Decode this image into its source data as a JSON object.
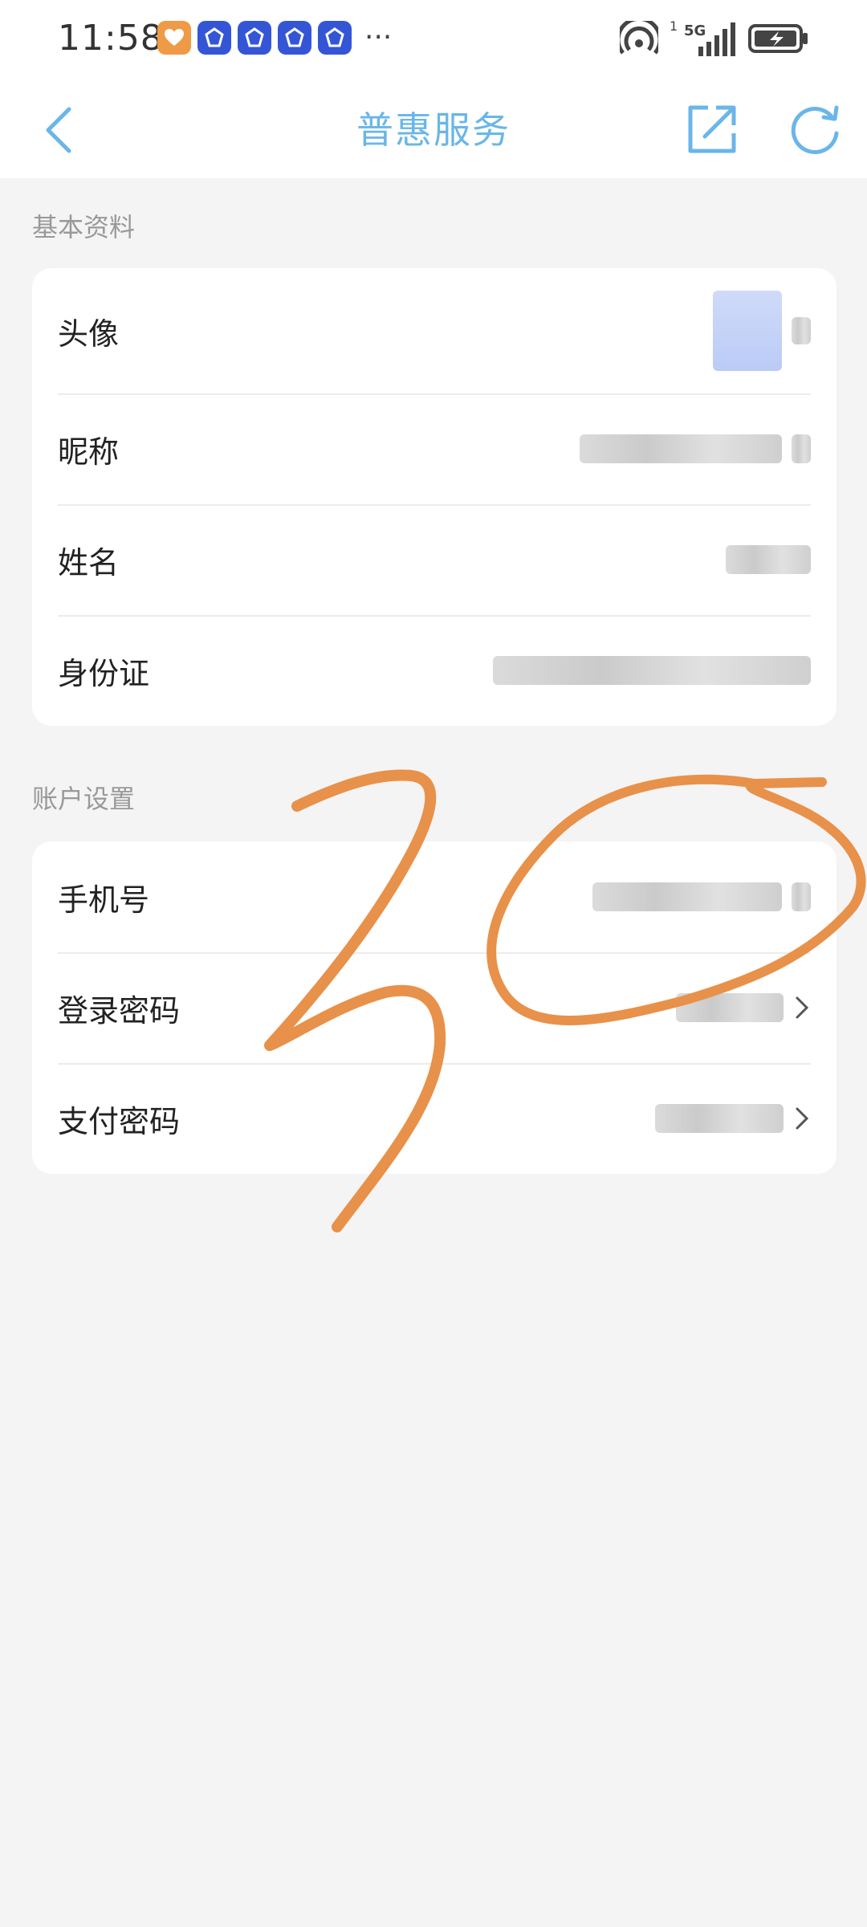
{
  "status_bar": {
    "time": "11:58",
    "more": "···",
    "signal_labels": [
      "1",
      "5G"
    ],
    "battery_icon": "battery-charging-icon"
  },
  "header": {
    "title": "普惠服务",
    "back_icon": "back-chevron-icon",
    "share_icon": "share-icon",
    "refresh_icon": "refresh-icon"
  },
  "basic_info": {
    "section_title": "基本资料",
    "rows": [
      {
        "label": "头像"
      },
      {
        "label": "昵称"
      },
      {
        "label": "姓名"
      },
      {
        "label": "身份证"
      }
    ]
  },
  "account_settings": {
    "section_title": "账户设置",
    "rows": [
      {
        "label": "手机号"
      },
      {
        "label": "登录密码"
      },
      {
        "label": "支付密码"
      }
    ]
  },
  "colors": {
    "accent": "#6ab6e8",
    "background": "#f4f4f4",
    "annotation": "#e8914a"
  }
}
